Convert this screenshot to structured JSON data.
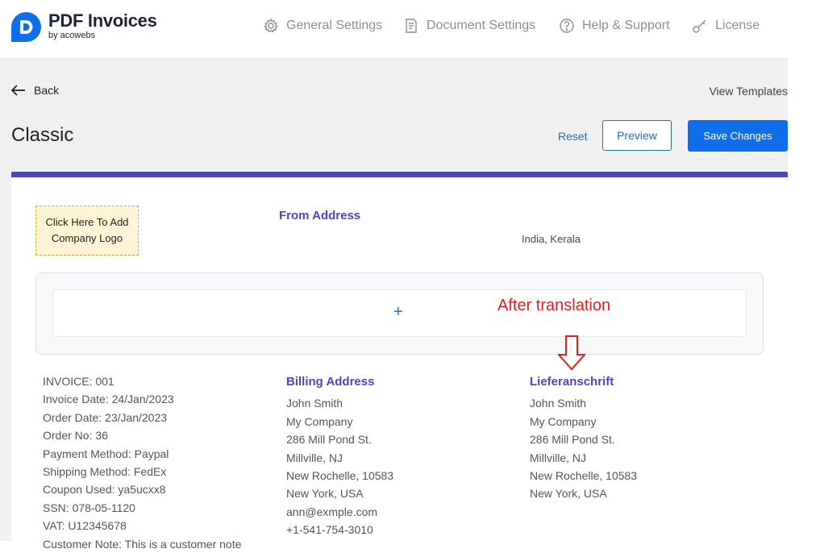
{
  "brand": {
    "name": "PDF Invoices",
    "sub": "by acowebs",
    "accent": "#0f6fea"
  },
  "nav": {
    "items": [
      {
        "label": "General Settings",
        "icon": "gear-icon"
      },
      {
        "label": "Document Settings",
        "icon": "document-icon"
      },
      {
        "label": "Help & Support",
        "icon": "help-icon"
      },
      {
        "label": "License",
        "icon": "key-icon"
      }
    ]
  },
  "toolbar": {
    "back_label": "Back",
    "view_templates_label": "View Templates",
    "page_title": "Classic",
    "reset_label": "Reset",
    "preview_label": "Preview",
    "save_label": "Save Changes"
  },
  "invoice": {
    "logo_placeholder": "Click Here To Add Company Logo",
    "from_title": "From Address",
    "from_line": "India, Kerala",
    "add_symbol": "+",
    "annotation": "After translation",
    "info_lines": [
      "INVOICE: 001",
      "Invoice Date: 24/Jan/2023",
      "Order Date: 23/Jan/2023",
      "Order No: 36",
      "Payment Method: Paypal",
      "Shipping Method: FedEx",
      "Coupon Used: ya5ucxx8",
      "SSN: 078-05-1120",
      "VAT: U12345678",
      "Customer Note: This is a customer note"
    ],
    "billing": {
      "title": "Billing Address",
      "lines": [
        "John Smith",
        "My Company",
        "286 Mill Pond St.",
        "Millville, NJ",
        "New Rochelle, 10583",
        "New York, USA",
        "ann@exmple.com",
        "+1-541-754-3010"
      ]
    },
    "shipping": {
      "title": "Lieferanschrift",
      "lines": [
        "John Smith",
        "My Company",
        "286 Mill Pond St.",
        "Millville, NJ",
        "New Rochelle, 10583",
        "New York, USA"
      ]
    }
  },
  "colors": {
    "card_top_border": "#4a44c6",
    "heading": "#4a44c6",
    "annotation": "#e02020",
    "link": "#2271b1"
  }
}
